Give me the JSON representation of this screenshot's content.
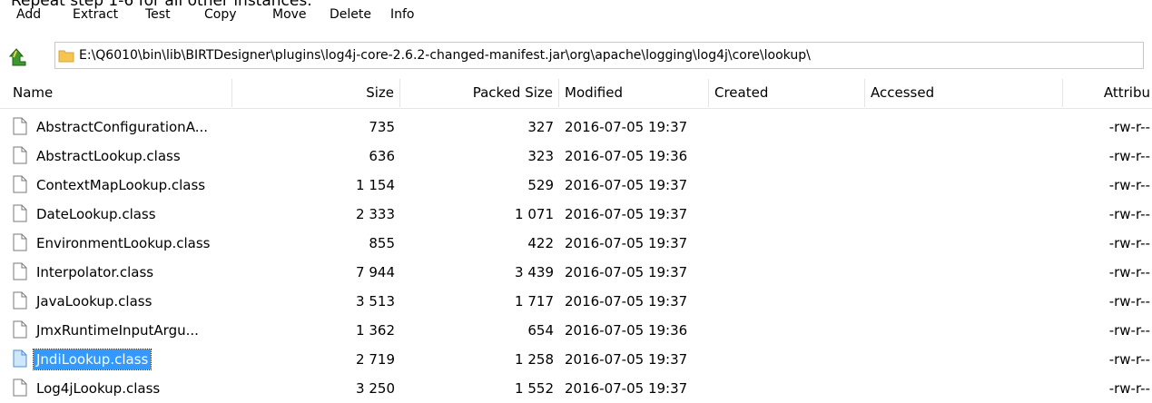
{
  "caption": "Repeat step 1-6 for all other instances.",
  "toolbar": {
    "add": "Add",
    "extract": "Extract",
    "test": "Test",
    "copy": "Copy",
    "move": "Move",
    "delete": "Delete",
    "info": "Info"
  },
  "address": {
    "path": "E:\\Q6010\\bin\\lib\\BIRTDesigner\\plugins\\log4j-core-2.6.2-changed-manifest.jar\\org\\apache\\logging\\log4j\\core\\lookup\\"
  },
  "columns": {
    "name": "Name",
    "size": "Size",
    "packed": "Packed Size",
    "modified": "Modified",
    "created": "Created",
    "accessed": "Accessed",
    "attributes": "Attribu"
  },
  "files": [
    {
      "name": "AbstractConfigurationA...",
      "size": "735",
      "packed": "327",
      "modified": "2016-07-05 19:37",
      "attr": "-rw-r--"
    },
    {
      "name": "AbstractLookup.class",
      "size": "636",
      "packed": "323",
      "modified": "2016-07-05 19:36",
      "attr": "-rw-r--"
    },
    {
      "name": "ContextMapLookup.class",
      "size": "1 154",
      "packed": "529",
      "modified": "2016-07-05 19:37",
      "attr": "-rw-r--"
    },
    {
      "name": "DateLookup.class",
      "size": "2 333",
      "packed": "1 071",
      "modified": "2016-07-05 19:37",
      "attr": "-rw-r--"
    },
    {
      "name": "EnvironmentLookup.class",
      "size": "855",
      "packed": "422",
      "modified": "2016-07-05 19:37",
      "attr": "-rw-r--"
    },
    {
      "name": "Interpolator.class",
      "size": "7 944",
      "packed": "3 439",
      "modified": "2016-07-05 19:37",
      "attr": "-rw-r--"
    },
    {
      "name": "JavaLookup.class",
      "size": "3 513",
      "packed": "1 717",
      "modified": "2016-07-05 19:37",
      "attr": "-rw-r--"
    },
    {
      "name": "JmxRuntimeInputArgu...",
      "size": "1 362",
      "packed": "654",
      "modified": "2016-07-05 19:36",
      "attr": "-rw-r--"
    },
    {
      "name": "JndiLookup.class",
      "size": "2 719",
      "packed": "1 258",
      "modified": "2016-07-05 19:37",
      "attr": "-rw-r--",
      "selected": true
    },
    {
      "name": "Log4jLookup.class",
      "size": "3 250",
      "packed": "1 552",
      "modified": "2016-07-05 19:37",
      "attr": "-rw-r--"
    }
  ],
  "colors": {
    "selection": "#3399ff",
    "folder": "#f5c451",
    "up_arrow": "#3a9a2b"
  }
}
